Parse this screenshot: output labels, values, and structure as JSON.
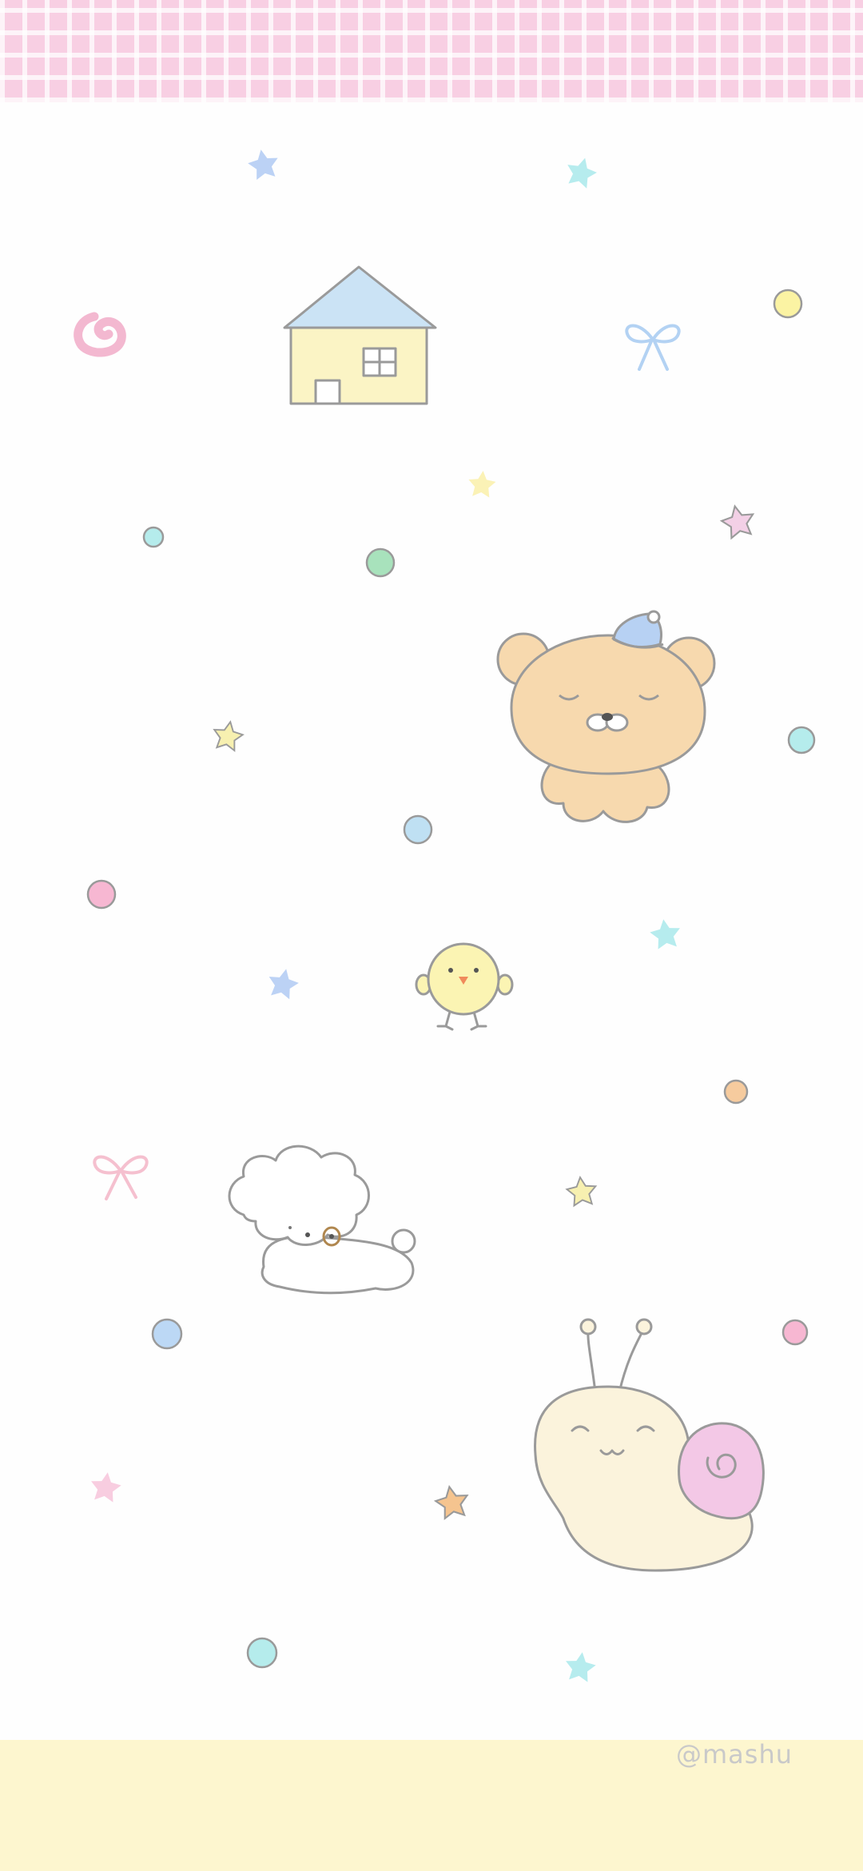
{
  "wallpaper": {
    "signature": "@mashu",
    "colors": {
      "top_band": "#f8cfe3",
      "bottom_band": "#fdf6cf",
      "background": "#fefefe",
      "bear": "#f7d9ae",
      "snail_body": "#fbf3dc",
      "snail_shell": "#f3c8e6",
      "chick": "#fbf4b3",
      "house_wall": "#fbf4c5",
      "house_roof": "#cbe3f5"
    },
    "icons": [
      "house-icon",
      "bear-with-nightcap-icon",
      "chick-icon",
      "puppy-icon",
      "snail-icon",
      "star-icon",
      "dot-icon",
      "ribbon-icon",
      "swirl-icon"
    ]
  }
}
